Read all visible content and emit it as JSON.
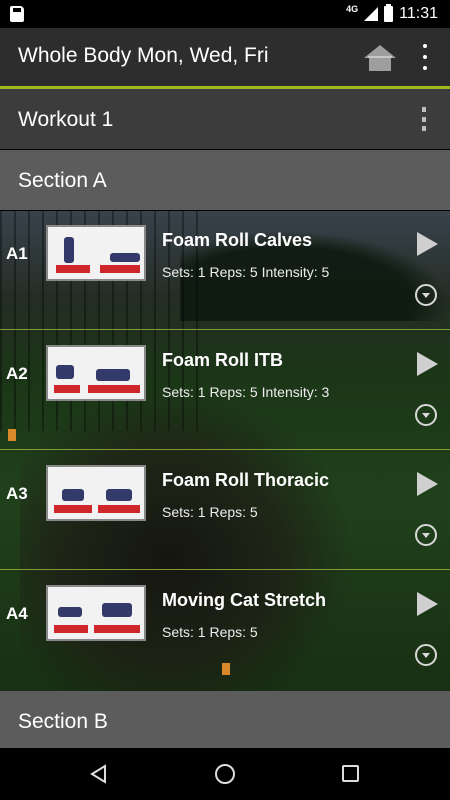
{
  "status_bar": {
    "network": "4G",
    "time": "11:31",
    "icons": [
      "sd-card-icon",
      "signal-icon",
      "battery-icon"
    ]
  },
  "app_bar": {
    "title": "Whole Body Mon, Wed, Fri",
    "icons": [
      "home-icon",
      "overflow-menu-icon"
    ]
  },
  "workout": {
    "title": "Workout 1"
  },
  "sections": [
    {
      "label": "Section A"
    },
    {
      "label": "Section B"
    }
  ],
  "exercises": [
    {
      "code": "A1",
      "title": "Foam Roll Calves",
      "meta": "Sets: 1   Reps: 5   Intensity: 5"
    },
    {
      "code": "A2",
      "title": "Foam Roll ITB",
      "meta": "Sets: 1   Reps: 5   Intensity: 3"
    },
    {
      "code": "A3",
      "title": "Foam Roll Thoracic",
      "meta": "Sets: 1   Reps: 5"
    },
    {
      "code": "A4",
      "title": "Moving Cat Stretch",
      "meta": "Sets: 1   Reps: 5"
    }
  ],
  "nav_bar": {
    "icons": [
      "back-icon",
      "home-circle-icon",
      "recents-icon"
    ]
  },
  "colors": {
    "accent": "#a3b81b",
    "app_bar": "#2d2d2d",
    "workout_bar": "#3c3c3c",
    "section_bar": "#5c5c5c"
  }
}
